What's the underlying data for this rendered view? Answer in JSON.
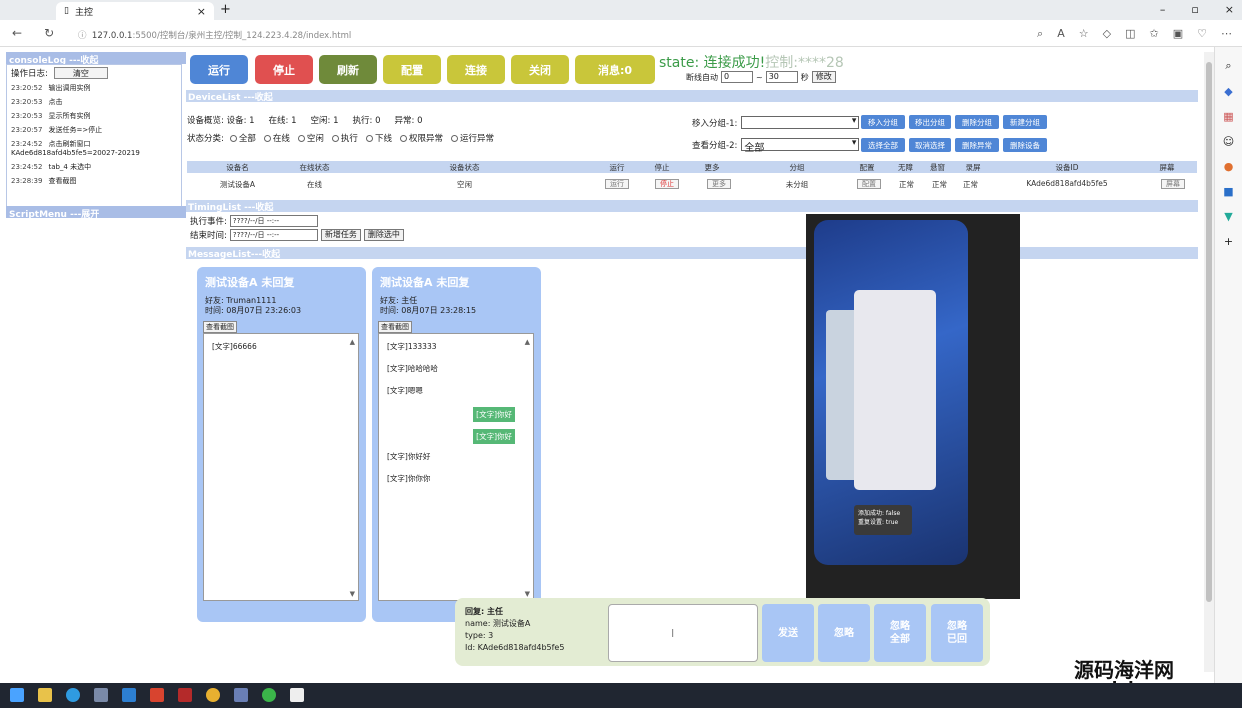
{
  "browser": {
    "tab_title": "主控",
    "url_host": "127.0.0.1",
    "url_rest": ":5500/控制台/泉州主控/控制_124.223.4.28/index.html"
  },
  "left": {
    "log_header": "consoleLog ---收起",
    "log_opt": "操作日志:",
    "clear": "清空",
    "logs": [
      {
        "t": "23:20:52",
        "m": "输出调用实例"
      },
      {
        "t": "23:20:53",
        "m": "点击"
      },
      {
        "t": "23:20:53",
        "m": "显示所有实例"
      },
      {
        "t": "23:20:57",
        "m": "发送任务=>停止"
      },
      {
        "t": "23:24:52",
        "m": "点击刷新窗口 KAde6d818afd4b5fe5=20027-20219"
      },
      {
        "t": "23:24:52",
        "m": "tab_4 未选中"
      },
      {
        "t": "23:28:39",
        "m": "查看截图"
      }
    ],
    "script_menu": "ScriptMenu ---展开"
  },
  "buttons": [
    {
      "label": "运行",
      "color": "#4f86d6"
    },
    {
      "label": "停止",
      "color": "#e05050"
    },
    {
      "label": "刷新",
      "color": "#6f8a3a"
    },
    {
      "label": "配置",
      "color": "#c9c63a"
    },
    {
      "label": "连接",
      "color": "#c9c63a"
    },
    {
      "label": "关闭",
      "color": "#c9c63a"
    },
    {
      "label": "消息:0",
      "color": "#c9c63a"
    }
  ],
  "state": {
    "label": "state:",
    "value": "连接成功!",
    "ctrl": "控制:****28"
  },
  "retry": {
    "label": "断线自动",
    "from": "0",
    "sep": "~",
    "to": "30",
    "unit": "秒",
    "btn": "修改"
  },
  "sections": {
    "device": "DeviceList ---收起",
    "timing": "TimingList ---收起",
    "message": "MessageList---收起"
  },
  "devinfo": {
    "total": "设备概览:  设备:  1",
    "online": "在线:  1",
    "idle": "空闲:  1",
    "run": "执行:  0",
    "err": "异常:  0"
  },
  "filter": {
    "label": "状态分类:",
    "opts": [
      "全部",
      "在线",
      "空闲",
      "执行",
      "下线",
      "权限异常",
      "运行异常"
    ]
  },
  "group1": {
    "label": "移入分组-1:",
    "value": "",
    "btns": [
      "移入分组",
      "移出分组",
      "删除分组",
      "新建分组"
    ]
  },
  "group2": {
    "label": "查看分组-2:",
    "value": "全部",
    "btns": [
      "选择全部",
      "取消选择",
      "删除异常",
      "删除设备"
    ]
  },
  "table": {
    "headers": [
      "设备名",
      "在线状态",
      "设备状态",
      "运行",
      "停止",
      "更多",
      "分组",
      "配置",
      "无障",
      "悬窗",
      "录屏",
      "设备ID",
      "屏幕"
    ],
    "row": {
      "name": "测试设备A",
      "online": "在线",
      "status": "空闲",
      "run": "运行",
      "stop": "停止",
      "more": "更多",
      "group": "未分组",
      "cfg": "配置",
      "a": "正常",
      "b": "正常",
      "c": "正常",
      "id": "KAde6d818afd4b5fe5",
      "screen": "屏幕"
    }
  },
  "timing": {
    "start_label": "执行事件:",
    "end_label": "结束时间:",
    "date_ph": "????/--/日 --:--",
    "add": "新增任务",
    "del": "删除选中"
  },
  "messages": [
    {
      "title": "测试设备A 未回复",
      "friend": "好友:  Truman1111",
      "time": "时间:  08月07日 23:26:03",
      "shot": "查看截图",
      "items": [
        {
          "side": "l",
          "text": "[文字]66666"
        }
      ]
    },
    {
      "title": "测试设备A 未回复",
      "friend": "好友:  主任",
      "time": "时间:  08月07日 23:28:15",
      "shot": "查看截图",
      "items": [
        {
          "side": "l",
          "text": "[文字]133333"
        },
        {
          "side": "l",
          "text": "[文字]哈哈哈哈"
        },
        {
          "side": "l",
          "text": "[文字]嗯嗯"
        },
        {
          "side": "r",
          "text": "[文字]你好"
        },
        {
          "side": "r",
          "text": "[文字]你好"
        },
        {
          "side": "l",
          "text": "[文字]你好好"
        },
        {
          "side": "l",
          "text": "[文字]你你你"
        }
      ]
    }
  ],
  "phone": {
    "toast1": "添加成功: false",
    "toast2": "重复设置: true"
  },
  "reply": {
    "to": "回复:  主任",
    "name": "name:  测试设备A",
    "type": "type:  3",
    "id": "Id:  KAde6d818afd4b5fe5",
    "btns": [
      "发送",
      "忽略",
      "忽略\n全部",
      "忽略\n已回"
    ]
  },
  "watermark": {
    "line1": "源码海洋网",
    "line2": "www.codehy.com"
  }
}
